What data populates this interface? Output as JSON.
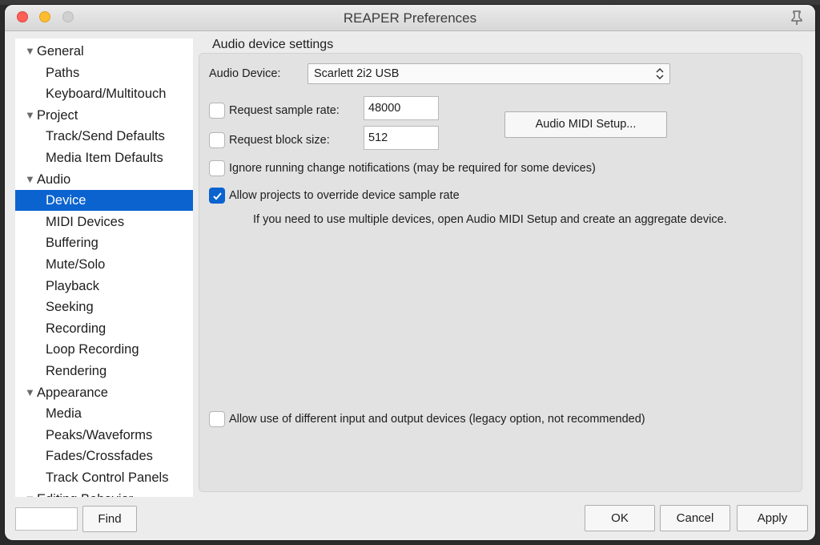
{
  "window": {
    "title": "REAPER Preferences"
  },
  "sidebar": {
    "items": [
      {
        "label": "General",
        "type": "category",
        "name": "sidebar-item-general"
      },
      {
        "label": "Paths",
        "type": "sub",
        "name": "sidebar-item-paths"
      },
      {
        "label": "Keyboard/Multitouch",
        "type": "sub",
        "name": "sidebar-item-keyboard-multitouch"
      },
      {
        "label": "Project",
        "type": "category",
        "name": "sidebar-item-project"
      },
      {
        "label": "Track/Send Defaults",
        "type": "sub",
        "name": "sidebar-item-track-send-defaults"
      },
      {
        "label": "Media Item Defaults",
        "type": "sub",
        "name": "sidebar-item-media-item-defaults"
      },
      {
        "label": "Audio",
        "type": "category",
        "name": "sidebar-item-audio"
      },
      {
        "label": "Device",
        "type": "sub",
        "selected": true,
        "name": "sidebar-item-device"
      },
      {
        "label": "MIDI Devices",
        "type": "sub",
        "name": "sidebar-item-midi-devices"
      },
      {
        "label": "Buffering",
        "type": "sub",
        "name": "sidebar-item-buffering"
      },
      {
        "label": "Mute/Solo",
        "type": "sub",
        "name": "sidebar-item-mute-solo"
      },
      {
        "label": "Playback",
        "type": "sub",
        "name": "sidebar-item-playback"
      },
      {
        "label": "Seeking",
        "type": "sub",
        "name": "sidebar-item-seeking"
      },
      {
        "label": "Recording",
        "type": "sub",
        "name": "sidebar-item-recording"
      },
      {
        "label": "Loop Recording",
        "type": "sub",
        "name": "sidebar-item-loop-recording"
      },
      {
        "label": "Rendering",
        "type": "sub",
        "name": "sidebar-item-rendering"
      },
      {
        "label": "Appearance",
        "type": "category",
        "name": "sidebar-item-appearance"
      },
      {
        "label": "Media",
        "type": "sub",
        "name": "sidebar-item-media"
      },
      {
        "label": "Peaks/Waveforms",
        "type": "sub",
        "name": "sidebar-item-peaks-waveforms"
      },
      {
        "label": "Fades/Crossfades",
        "type": "sub",
        "name": "sidebar-item-fades-crossfades"
      },
      {
        "label": "Track Control Panels",
        "type": "sub",
        "name": "sidebar-item-track-control-panels"
      },
      {
        "label": "Editing Behavior",
        "type": "category",
        "name": "sidebar-item-editing-behavior"
      }
    ],
    "find_value": "",
    "find_button": "Find"
  },
  "panel": {
    "title": "Audio device settings",
    "audio_device_label": "Audio Device:",
    "audio_device_value": "Scarlett 2i2 USB",
    "request_sample_rate": {
      "label": "Request sample rate:",
      "value": "48000",
      "checked": false
    },
    "request_block_size": {
      "label": "Request block size:",
      "value": "512",
      "checked": false
    },
    "audio_midi_setup_button": "Audio MIDI Setup...",
    "ignore_notifications": {
      "label": "Ignore running change notifications (may be required for some devices)",
      "checked": false
    },
    "allow_override": {
      "label": "Allow projects to override device sample rate",
      "checked": true
    },
    "info_text": "If you need to use multiple devices, open Audio MIDI Setup and create an aggregate device.",
    "allow_different_devices": {
      "label": "Allow use of different input and output devices (legacy option, not recommended)",
      "checked": false
    }
  },
  "footer": {
    "ok": "OK",
    "cancel": "Cancel",
    "apply": "Apply"
  },
  "colors": {
    "accent": "#0b63d0",
    "panel_bg": "#e2e2e2",
    "window_bg": "#ececec"
  },
  "icons": [
    "close-light",
    "minimize-light",
    "zoom-light",
    "pin-icon",
    "chevron-updown-icon",
    "checkmark-icon",
    "disclosure-triangle-icon"
  ]
}
